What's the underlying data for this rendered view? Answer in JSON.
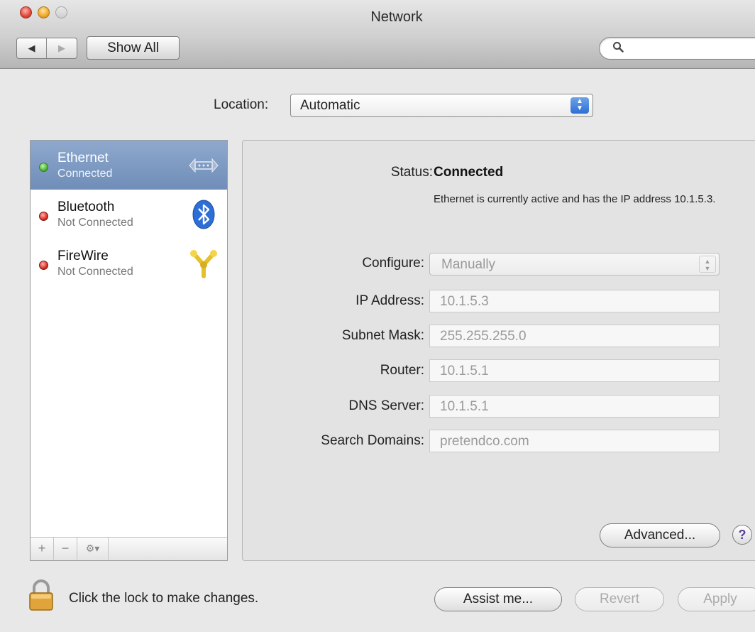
{
  "window": {
    "title": "Network"
  },
  "toolbar": {
    "back_glyph": "◀",
    "forward_glyph": "▶",
    "show_all_label": "Show All",
    "search_icon": "search-icon",
    "search_placeholder": ""
  },
  "location": {
    "label": "Location:",
    "value": "Automatic"
  },
  "services": [
    {
      "name": "Ethernet",
      "status": "Connected",
      "state": "connected",
      "icon": "ethernet-icon",
      "selected": true
    },
    {
      "name": "Bluetooth",
      "status": "Not Connected",
      "state": "disconnected",
      "icon": "bluetooth-icon",
      "selected": false
    },
    {
      "name": "FireWire",
      "status": "Not Connected",
      "state": "disconnected",
      "icon": "firewire-icon",
      "selected": false
    }
  ],
  "sidebar_footer": {
    "add": "+",
    "remove": "−",
    "action": "⚙▾"
  },
  "detail": {
    "status_label": "Status:",
    "status_value": "Connected",
    "status_description": "Ethernet is currently active and has the IP address 10.1.5.3.",
    "configure": {
      "label": "Configure:",
      "value": "Manually"
    },
    "fields": [
      {
        "label": "IP Address:",
        "value": "10.1.5.3"
      },
      {
        "label": "Subnet Mask:",
        "value": "255.255.255.0"
      },
      {
        "label": "Router:",
        "value": "10.1.5.1"
      },
      {
        "label": "DNS Server:",
        "value": "10.1.5.1"
      },
      {
        "label": "Search Domains:",
        "value": "pretendco.com"
      }
    ],
    "advanced_label": "Advanced...",
    "help_label": "?"
  },
  "footer": {
    "lock_text": "Click the lock to make changes.",
    "assist_label": "Assist me...",
    "revert_label": "Revert",
    "apply_label": "Apply"
  },
  "colors": {
    "selection": "#7f9bc3",
    "connected": "#43b52b",
    "disconnected": "#d8281e"
  }
}
